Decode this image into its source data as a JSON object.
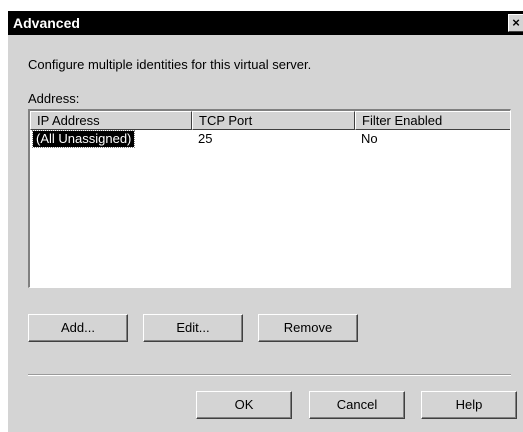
{
  "window": {
    "title": "Advanced",
    "close_glyph": "×"
  },
  "description": "Configure multiple identities for this virtual server.",
  "address_label": "Address:",
  "table": {
    "columns": [
      "IP Address",
      "TCP Port",
      "Filter Enabled"
    ],
    "rows": [
      {
        "ip": "(All Unassigned)",
        "port": "25",
        "filter": "No"
      }
    ]
  },
  "buttons": {
    "add": "Add...",
    "edit": "Edit...",
    "remove": "Remove",
    "ok": "OK",
    "cancel": "Cancel",
    "help": "Help"
  },
  "colors": {
    "face": "#d4d4d4",
    "titlebar": "#000000",
    "selection": "#000000"
  }
}
